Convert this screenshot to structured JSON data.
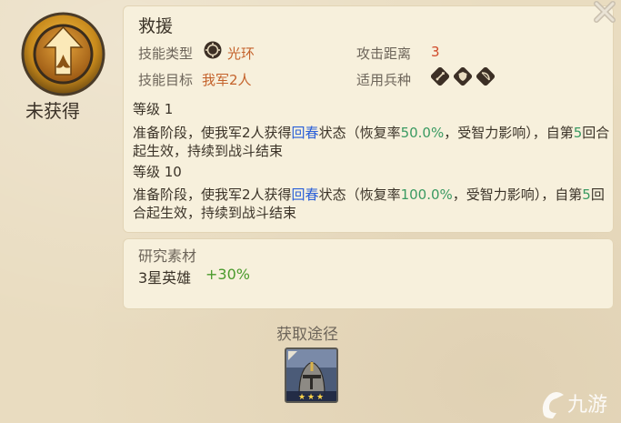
{
  "skill": {
    "name": "救援",
    "status": "未获得",
    "type_label": "技能类型",
    "type_value": "光环",
    "range_label": "攻击距离",
    "range_value": "3",
    "target_label": "技能目标",
    "target_value": "我军2人",
    "troops_label": "适用兵种",
    "troop_icons": [
      "sword-icon",
      "shield-icon",
      "bow-icon"
    ],
    "type_icon": "aura-icon"
  },
  "levels": [
    {
      "label": "等级 1",
      "desc_a": "准备阶段，使我军2人获得",
      "keyword": "回春",
      "desc_b": "状态（恢复率",
      "rate": "50.0%",
      "desc_c": "，受智力影响），自第",
      "turn": "5",
      "desc_d": "回合起生效，持续到战斗结束"
    },
    {
      "label": "等级 10",
      "desc_a": "准备阶段，使我军2人获得",
      "keyword": "回春",
      "desc_b": "状态（恢复率",
      "rate": "100.0%",
      "desc_c": "，受智力影响），自第",
      "turn": "5",
      "desc_d": "回合起生效，持续到战斗结束"
    }
  ],
  "research": {
    "title": "研究素材",
    "hero": "3星英雄",
    "bonus": "+30%"
  },
  "obtain": {
    "title": "获取途径",
    "hero_stars": 3
  },
  "watermark": "九游",
  "colors": {
    "background": "#e9dcc0",
    "panel": "#f7f0dc",
    "orange": "#c4622b",
    "blue_keyword": "#2a5fd8",
    "green_value": "#3a9a62",
    "bonus_green": "#4a9a2c"
  }
}
